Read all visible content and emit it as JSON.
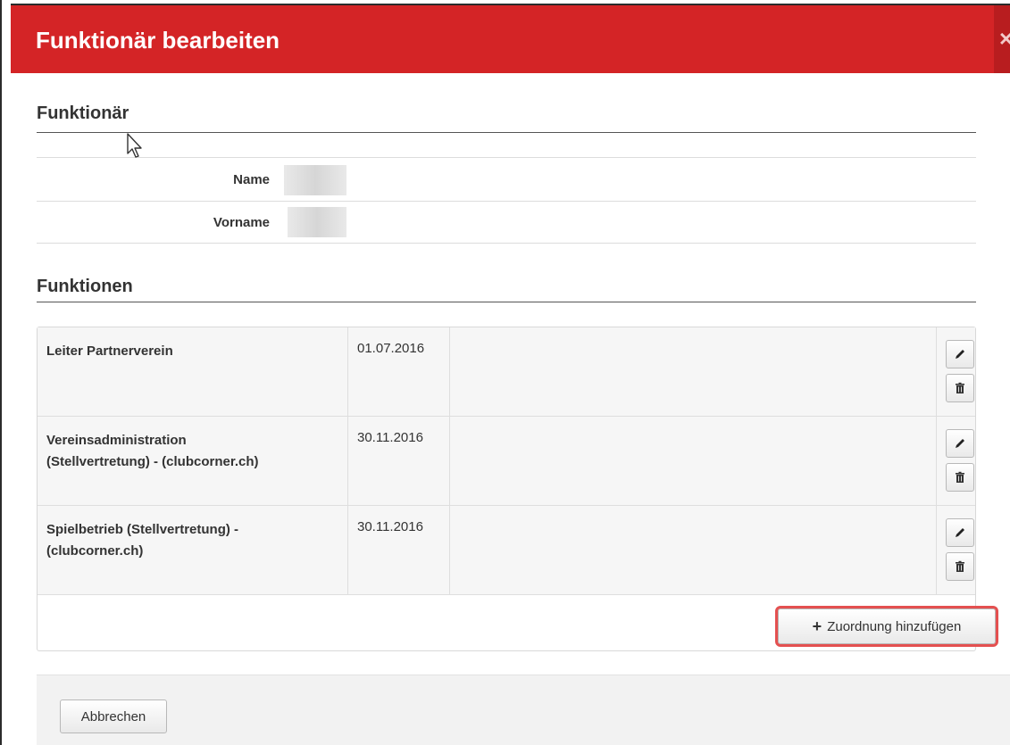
{
  "modal": {
    "title": "Funktionär bearbeiten",
    "close_glyph": "×"
  },
  "funktionaer": {
    "heading": "Funktionär",
    "fields": [
      {
        "label": "Name",
        "value": ""
      },
      {
        "label": "Vorname",
        "value": ""
      }
    ]
  },
  "funktionen": {
    "heading": "Funktionen",
    "rows": [
      {
        "name_line1": "Leiter Partnerverein",
        "name_line2": "",
        "date": "01.07.2016"
      },
      {
        "name_line1": "Vereinsadministration",
        "name_line2": "(Stellvertretung) - (clubcorner.ch)",
        "date": "30.11.2016"
      },
      {
        "name_line1": "Spielbetrieb (Stellvertretung) -",
        "name_line2": "(clubcorner.ch)",
        "date": "30.11.2016"
      }
    ],
    "row_icons": {
      "edit": "pencil-icon",
      "delete": "trash-icon"
    },
    "add_button": {
      "icon": "plus-icon",
      "label": "Zuordnung hinzufügen"
    }
  },
  "footer": {
    "cancel_label": "Abbrechen"
  },
  "colors": {
    "header": "#d42426",
    "highlight": "#e45050"
  }
}
